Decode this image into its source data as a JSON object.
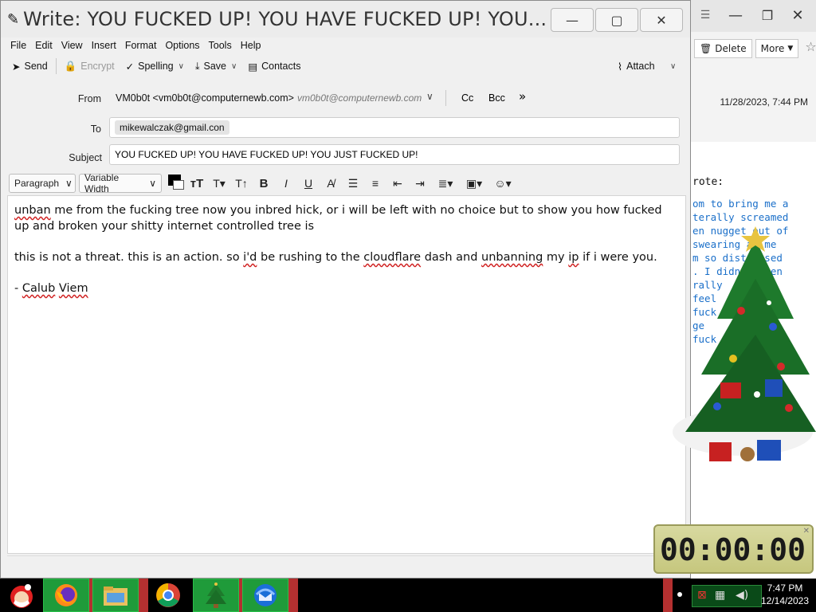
{
  "compose": {
    "title": "Write: YOU FUCKED UP! YOU HAVE FUCKED UP! YOU...",
    "menu": [
      "File",
      "Edit",
      "View",
      "Insert",
      "Format",
      "Options",
      "Tools",
      "Help"
    ],
    "toolbar": {
      "send": "Send",
      "encrypt": "Encrypt",
      "spelling": "Spelling",
      "save": "Save",
      "contacts": "Contacts",
      "attach": "Attach"
    },
    "header": {
      "from_label": "From",
      "from_name": "VM0b0t <vm0b0t@computernewb.com>",
      "from_alias": "vm0b0t@computernewb.com",
      "cc": "Cc",
      "bcc": "Bcc",
      "to_label": "To",
      "to_value": "mikewalczak@gmail.con",
      "subject_label": "Subject",
      "subject_value": "YOU FUCKED UP! YOU HAVE FUCKED UP! YOU JUST FUCKED UP!"
    },
    "format": {
      "paragraph": "Paragraph",
      "font": "Variable Width"
    },
    "body": {
      "p1_w1": "unban",
      "p1_rest": " me from the fucking tree now you inbred hick, or i will be left with no choice but to show you how fucked up and broken your shitty internet controlled tree is",
      "p2_a": "this is not a threat. this is an action. so ",
      "p2_id": "i'd",
      "p2_b": " be rushing to the ",
      "p2_cf": "cloudflare",
      "p2_c": " dash and ",
      "p2_unb": "unbanning",
      "p2_d": " my ",
      "p2_ip": "ip",
      "p2_e": " if i were you.",
      "sig_a": "- ",
      "sig_b": "Calub",
      "sig_c": " ",
      "sig_d": "Viem"
    }
  },
  "background_window": {
    "delete": "Delete",
    "more": "More",
    "date": "11/28/2023, 7:44 PM",
    "wrote": "rote:",
    "quote_lines": [
      "om to bring me a",
      "terally screamed",
      "en nugget out of",
      " swearing at me",
      "m so distressed",
      ". I didn't even",
      "rally ",
      " feel",
      " fuck",
      "ge",
      "fuck"
    ]
  },
  "timer": {
    "display": "00:00:00"
  },
  "taskbar": {
    "time": "7:47 PM",
    "date": "12/14/2023"
  }
}
